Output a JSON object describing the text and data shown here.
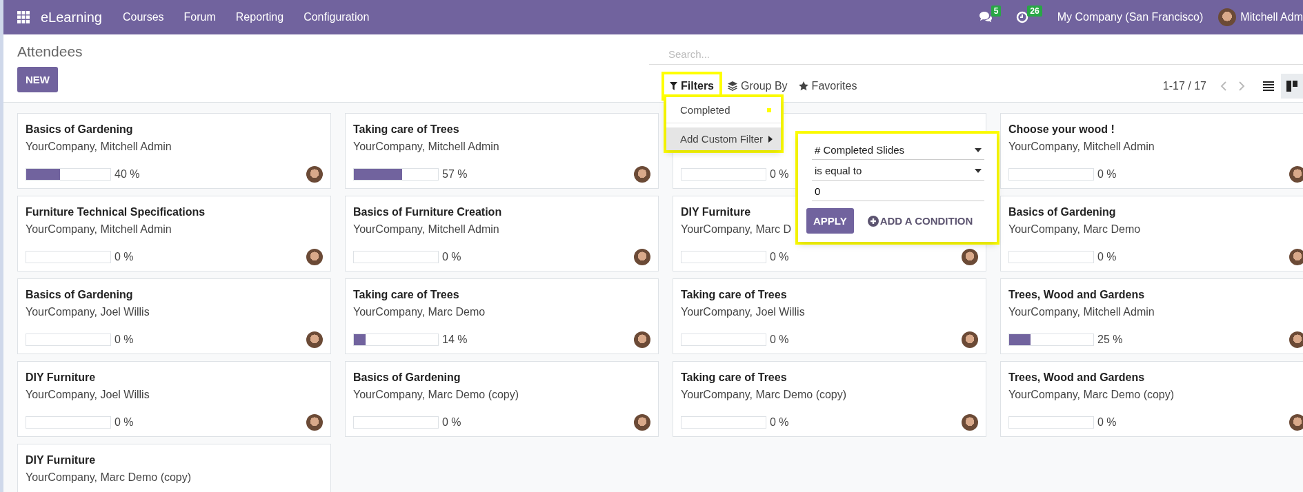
{
  "navbar": {
    "app_name": "eLearning",
    "menu": [
      "Courses",
      "Forum",
      "Reporting",
      "Configuration"
    ],
    "messages_count": "5",
    "activities_count": "26",
    "company": "My Company (San Francisco)",
    "user": "Mitchell Adm"
  },
  "control_panel": {
    "breadcrumb": "Attendees",
    "new_button": "NEW",
    "search": {
      "placeholder": "Search..."
    },
    "filters": {
      "label": "Filters",
      "highlighted": true
    },
    "group_by": "Group By",
    "favorites": "Favorites",
    "pager": "1-17 / 17",
    "views": [
      {
        "kind": "list",
        "selected": false
      },
      {
        "kind": "kanban",
        "selected": true
      }
    ]
  },
  "filter_menu": {
    "highlighted": true,
    "items": [
      {
        "label": "Completed",
        "kind": "filter",
        "selected": false
      },
      {
        "label": "Add Custom Filter",
        "kind": "submenu",
        "selected": true
      }
    ],
    "custom_filter": {
      "highlighted": true,
      "field": "# Completed Slides",
      "operator": "is equal to",
      "value": "0",
      "apply": "APPLY",
      "add_condition": "ADD A CONDITION"
    }
  },
  "cards": [
    {
      "title": "Basics of Gardening",
      "subtitle": "YourCompany, Mitchell Admin",
      "level": 0.4,
      "percent": "40 %"
    },
    {
      "title": "Taking care of Trees",
      "subtitle": "YourCompany, Mitchell Admin",
      "level": 0.57,
      "percent": "57 %"
    },
    {
      "level": 0,
      "percent": "0 %"
    },
    {
      "title": "Choose your wood !",
      "subtitle": "YourCompany, Mitchell Admin",
      "level": 0,
      "percent": "0 %"
    },
    {
      "title": "Furniture Technical Specifications",
      "subtitle": "YourCompany, Mitchell Admin",
      "level": 0,
      "percent": "0 %"
    },
    {
      "title": "Basics of Furniture Creation",
      "subtitle": "YourCompany, Mitchell Admin",
      "level": 0,
      "percent": "0 %"
    },
    {
      "title": "DIY Furniture",
      "subtitle": "YourCompany, Marc D",
      "level": 0,
      "percent": "0 %"
    },
    {
      "title": "Basics of Gardening",
      "subtitle": "YourCompany, Marc Demo",
      "level": 0,
      "percent": "0 %"
    },
    {
      "title": "Basics of Gardening",
      "subtitle": "YourCompany, Joel Willis",
      "level": 0,
      "percent": "0 %"
    },
    {
      "title": "Taking care of Trees",
      "subtitle": "YourCompany, Marc Demo",
      "level": 0.14,
      "percent": "14 %"
    },
    {
      "title": "Taking care of Trees",
      "subtitle": "YourCompany, Joel Willis",
      "level": 0,
      "percent": "0 %"
    },
    {
      "title": "Trees, Wood and Gardens",
      "subtitle": "YourCompany, Mitchell Admin",
      "level": 0.25,
      "percent": "25 %"
    },
    {
      "title": "DIY Furniture",
      "subtitle": "YourCompany, Joel Willis",
      "level": 0,
      "percent": "0 %"
    },
    {
      "title": "Basics of Gardening",
      "subtitle": "YourCompany, Marc Demo (copy)",
      "level": 0,
      "percent": "0 %"
    },
    {
      "title": "Taking care of Trees",
      "subtitle": "YourCompany, Marc Demo (copy)",
      "level": 0,
      "percent": "0 %"
    },
    {
      "title": "Trees, Wood and Gardens",
      "subtitle": "YourCompany, Marc Demo (copy)",
      "level": 0,
      "percent": "0 %"
    },
    {
      "title": "DIY Furniture",
      "subtitle": "YourCompany, Marc Demo (copy)"
    }
  ]
}
